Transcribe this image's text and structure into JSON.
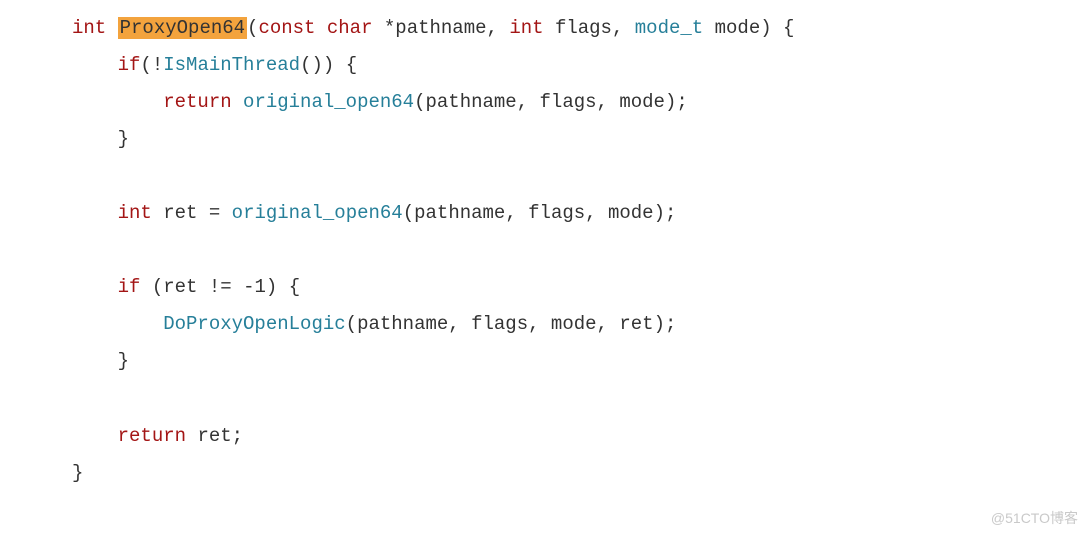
{
  "code": {
    "kw_int": "int",
    "fn_proxyopen64": "ProxyOpen64",
    "kw_const": "const",
    "kw_char": "char",
    "star": "*",
    "id_pathname": "pathname",
    "id_flags": "flags",
    "ty_mode_t": "mode_t",
    "id_mode": "mode",
    "kw_if": "if",
    "fn_isMainThread": "IsMainThread",
    "kw_return": "return",
    "fn_original_open64": "original_open64",
    "id_ret": "ret",
    "neq": "!=",
    "minus1": "-1",
    "fn_doProxyOpenLogic": "DoProxyOpenLogic",
    "lparen": "(",
    "rparen": ")",
    "lbrace": "{",
    "rbrace": "}",
    "comma": ",",
    "semi": ";",
    "bang": "!",
    "eq": "="
  },
  "watermark": "@51CTO博客"
}
